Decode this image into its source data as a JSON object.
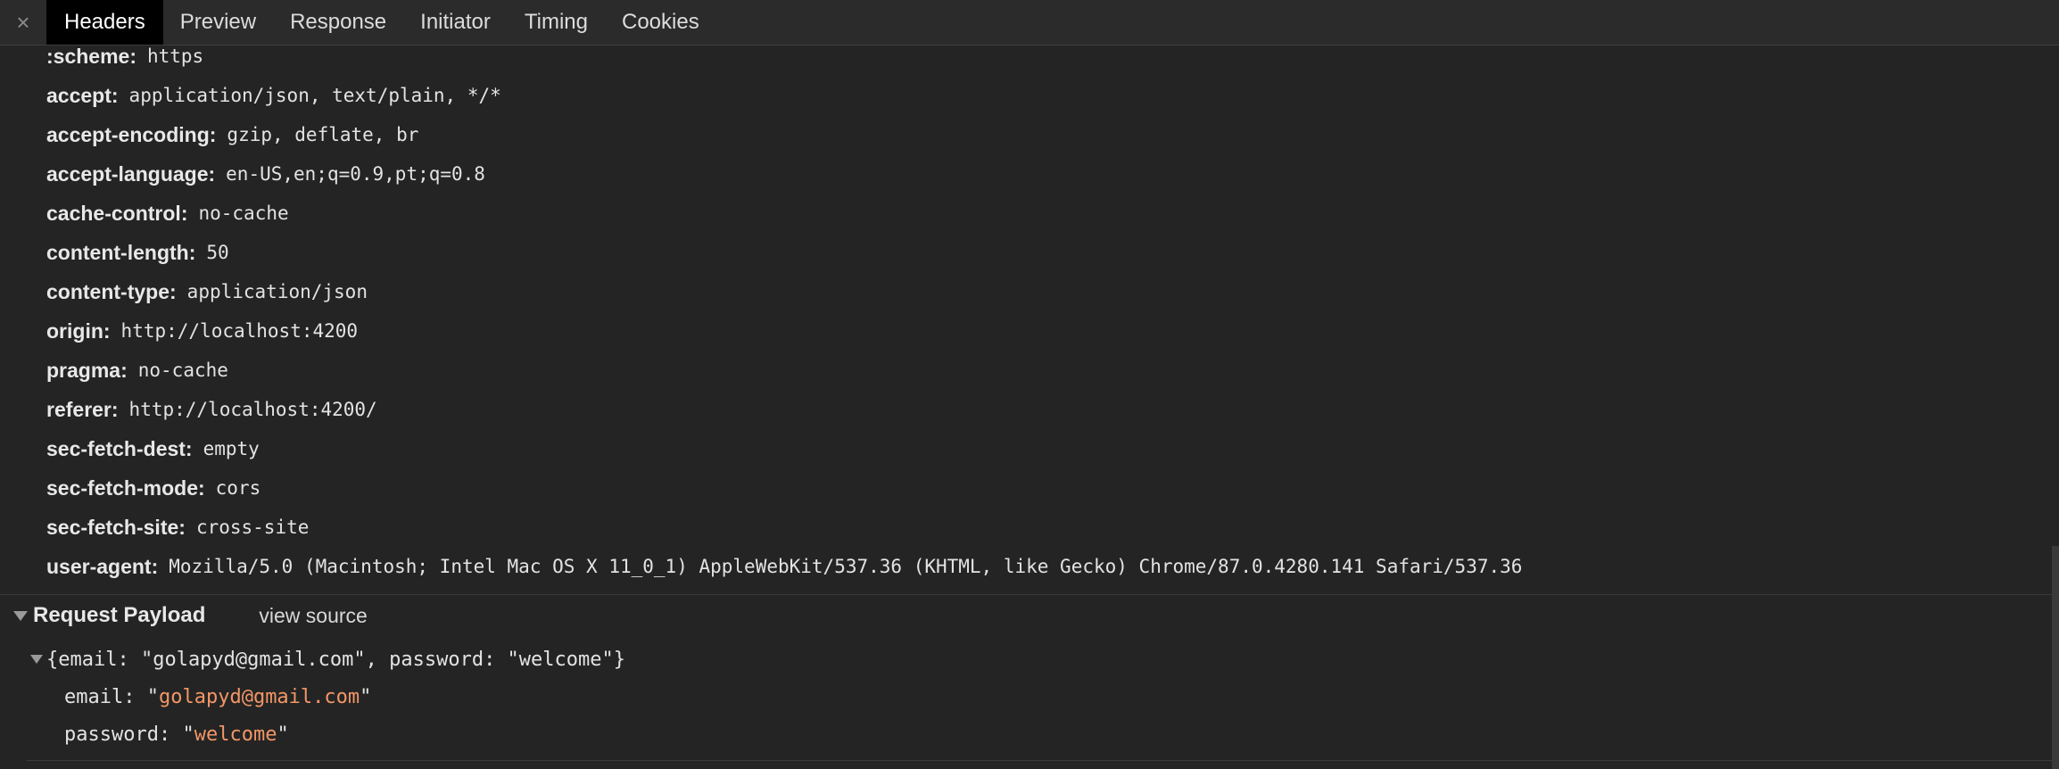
{
  "tabs": {
    "close_glyph": "×",
    "items": [
      "Headers",
      "Preview",
      "Response",
      "Initiator",
      "Timing",
      "Cookies"
    ],
    "active": "Headers"
  },
  "request_headers": [
    {
      "name": ":scheme:",
      "value": "https"
    },
    {
      "name": "accept:",
      "value": "application/json, text/plain, */*"
    },
    {
      "name": "accept-encoding:",
      "value": "gzip, deflate, br"
    },
    {
      "name": "accept-language:",
      "value": "en-US,en;q=0.9,pt;q=0.8"
    },
    {
      "name": "cache-control:",
      "value": "no-cache"
    },
    {
      "name": "content-length:",
      "value": "50"
    },
    {
      "name": "content-type:",
      "value": "application/json"
    },
    {
      "name": "origin:",
      "value": "http://localhost:4200"
    },
    {
      "name": "pragma:",
      "value": "no-cache"
    },
    {
      "name": "referer:",
      "value": "http://localhost:4200/"
    },
    {
      "name": "sec-fetch-dest:",
      "value": "empty"
    },
    {
      "name": "sec-fetch-mode:",
      "value": "cors"
    },
    {
      "name": "sec-fetch-site:",
      "value": "cross-site"
    },
    {
      "name": "user-agent:",
      "value": "Mozilla/5.0 (Macintosh; Intel Mac OS X 11_0_1) AppleWebKit/537.36 (KHTML, like Gecko) Chrome/87.0.4280.141 Safari/537.36"
    }
  ],
  "payload": {
    "title": "Request Payload",
    "view_source": "view source",
    "summary": "{email: \"golapyd@gmail.com\", password: \"welcome\"}",
    "fields": [
      {
        "key": "email",
        "value": "golapyd@gmail.com"
      },
      {
        "key": "password",
        "value": "welcome"
      }
    ]
  },
  "colors": {
    "background": "#242424",
    "tabbar": "#2b2b2b",
    "active_tab": "#000000",
    "string_value": "#f29766"
  }
}
